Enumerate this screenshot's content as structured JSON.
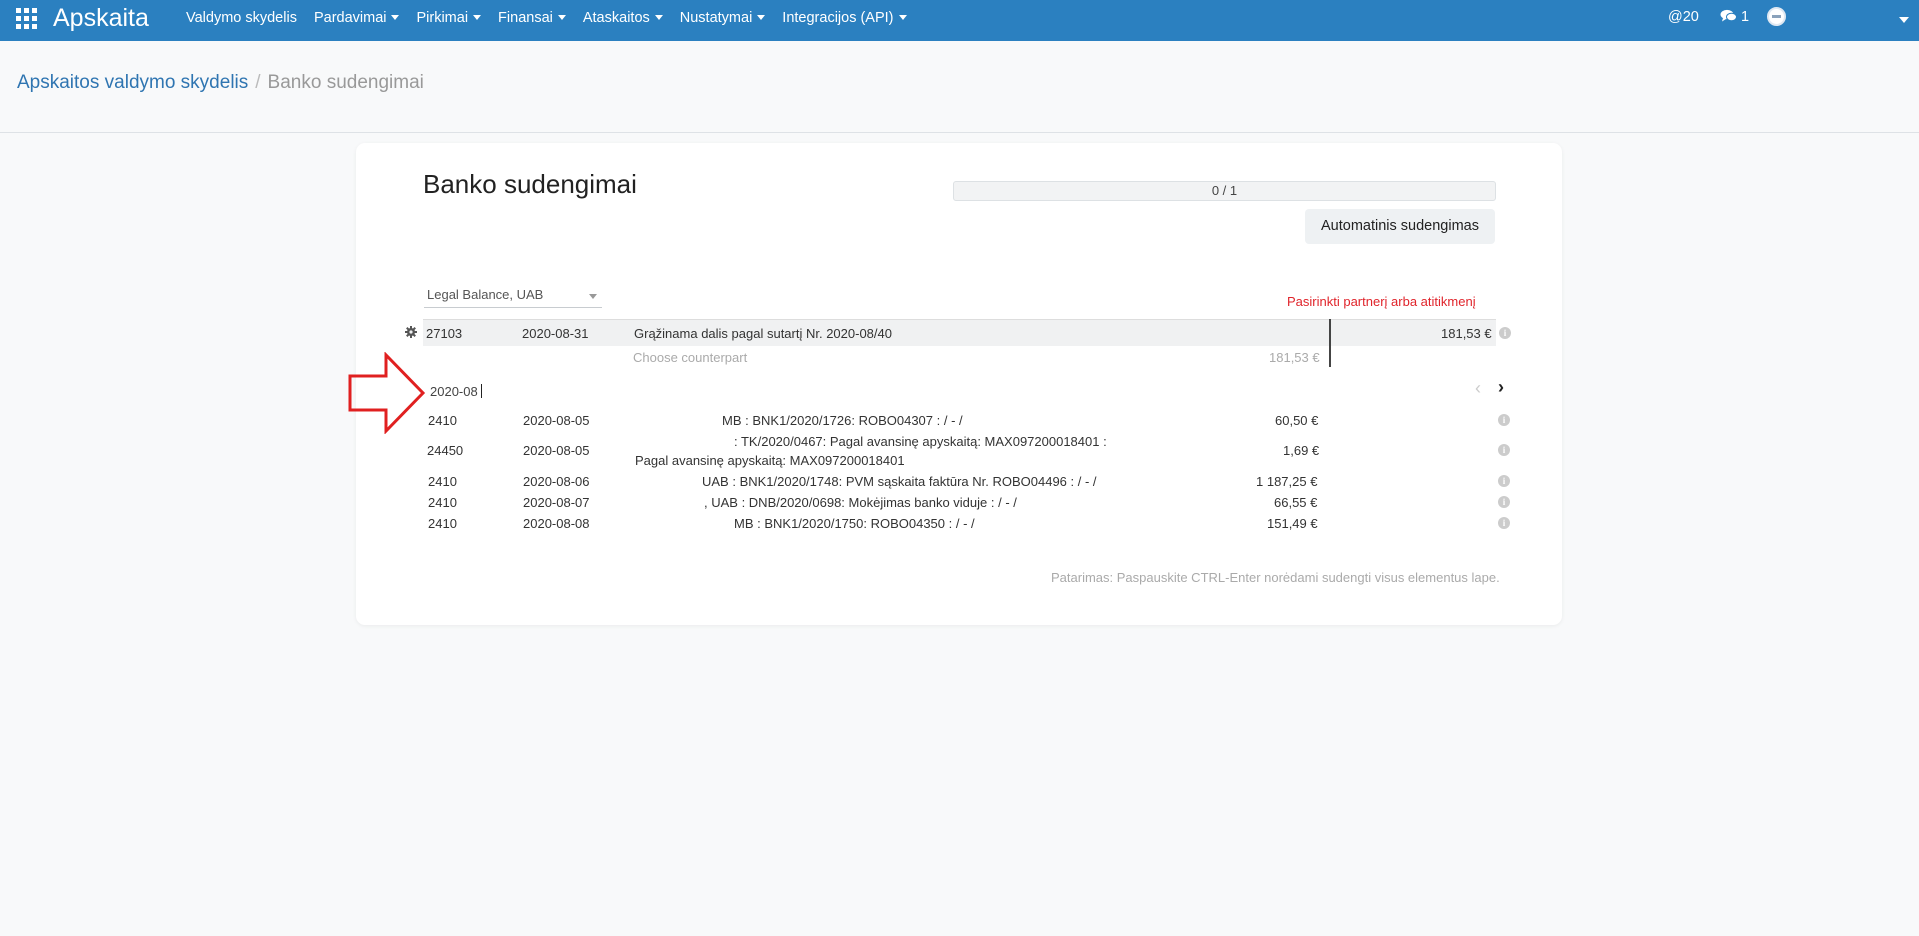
{
  "navbar": {
    "brand": "Apskaita",
    "menu": [
      {
        "label": "Valdymo skydelis",
        "caret": false
      },
      {
        "label": "Pardavimai",
        "caret": true
      },
      {
        "label": "Pirkimai",
        "caret": true
      },
      {
        "label": "Finansai",
        "caret": true
      },
      {
        "label": "Ataskaitos",
        "caret": true
      },
      {
        "label": "Nustatymai",
        "caret": true
      },
      {
        "label": "Integracijos (API)",
        "caret": true
      }
    ],
    "mentions": "@20",
    "messages": "1",
    "icons": {
      "apps": "apps-grid-icon",
      "messages": "comments-icon",
      "avatar": "user-avatar-icon"
    }
  },
  "breadcrumb": {
    "parent": "Apskaitos valdymo skydelis",
    "separator": "/",
    "current": "Banko sudengimai"
  },
  "page": {
    "title": "Banko sudengimai",
    "progress_text": "0 / 1",
    "auto_button": "Automatinis sudengimas",
    "company": "Legal Balance, UAB",
    "pick_partner": "Pasirinkti partnerį arba atitikmenį",
    "hint": "Patarimas: Paspauskite CTRL-Enter norėdami sudengti visus elementus lape."
  },
  "statement_line": {
    "account": "27103",
    "date": "2020-08-31",
    "description": "Grąžinama dalis pagal sutartį Nr. 2020-08/40",
    "amount": "181,53 €",
    "counterpart_placeholder": "Choose counterpart",
    "counterpart_amount": "181,53 €"
  },
  "search": {
    "value": "2020-08"
  },
  "candidates": [
    {
      "account": "2410",
      "date": "2020-08-05",
      "label": "MB : BNK1/2020/1726: ROBO04307 : / - /",
      "amount": "60,50 €"
    },
    {
      "account": "24450",
      "date": "2020-08-05",
      "label": ": TK/2020/0467: Pagal avansinę apyskaitą: MAX097200018401 :",
      "label2": "Pagal avansinę apyskaitą: MAX097200018401",
      "amount": "1,69 €"
    },
    {
      "account": "2410",
      "date": "2020-08-06",
      "label": "UAB : BNK1/2020/1748: PVM sąskaita faktūra Nr. ROBO04496 : / - /",
      "amount": "1 187,25 €"
    },
    {
      "account": "2410",
      "date": "2020-08-07",
      "label": ", UAB : DNB/2020/0698: Mokėjimas banko viduje : / - /",
      "amount": "66,55 €"
    },
    {
      "account": "2410",
      "date": "2020-08-08",
      "label": "MB : BNK1/2020/1750: ROBO04350 : / - /",
      "amount": "151,49 €"
    }
  ],
  "colors": {
    "navbar": "#2b80c0",
    "link": "#2f75b1",
    "alert_red": "#e0242b",
    "annotation_arrow": "#e02020"
  }
}
